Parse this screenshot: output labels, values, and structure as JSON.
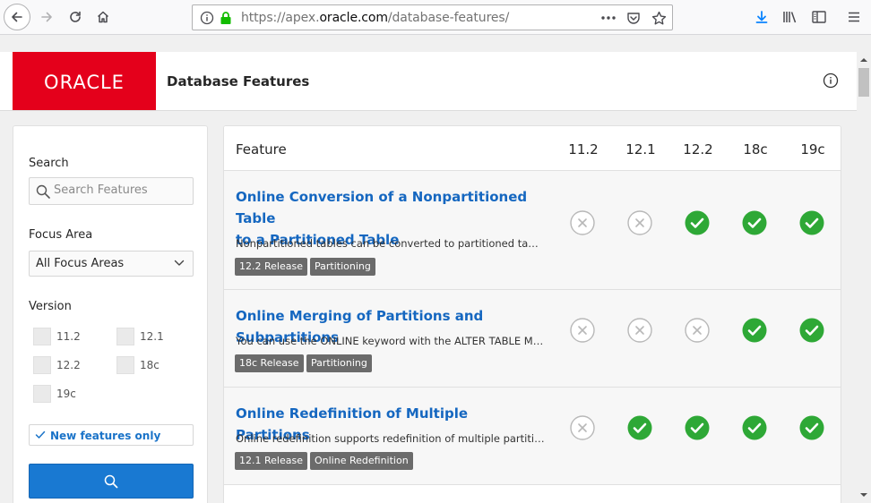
{
  "browser": {
    "url_prefix": "https://apex.",
    "url_host": "oracle.com",
    "url_path": "/database-features/"
  },
  "header": {
    "logo_text": "ORACLE",
    "title": "Database Features"
  },
  "sidebar": {
    "search_label": "Search",
    "search_placeholder": "Search Features",
    "focus_label": "Focus Area",
    "focus_value": "All Focus Areas",
    "version_label": "Version",
    "versions": [
      "11.2",
      "12.1",
      "12.2",
      "18c",
      "19c"
    ],
    "new_features_label": "New features only"
  },
  "table": {
    "feature_header": "Feature",
    "version_headers": [
      "11.2",
      "12.1",
      "12.2",
      "18c",
      "19c"
    ],
    "rows": [
      {
        "title_line1": "Online Conversion of a Nonpartitioned Table",
        "title_line2": "to a Partitioned Table",
        "description": "Nonpartitioned tables can be converted to partitioned tables o...",
        "tags": [
          "12.2 Release",
          "Partitioning"
        ],
        "support": [
          false,
          false,
          true,
          true,
          true
        ]
      },
      {
        "title_line1": "Online Merging of Partitions and Subpartitions",
        "title_line2": "",
        "description": "You can use the ONLINE keyword with the ALTER TABLE MERG...",
        "tags": [
          "18c Release",
          "Partitioning"
        ],
        "support": [
          false,
          false,
          false,
          true,
          true
        ]
      },
      {
        "title_line1": "Online Redefinition of Multiple Partitions",
        "title_line2": "",
        "description": "Online redefinition supports redefinition of multiple partitions i...",
        "tags": [
          "12.1 Release",
          "Online Redefinition"
        ],
        "support": [
          false,
          true,
          true,
          true,
          true
        ]
      }
    ]
  },
  "colors": {
    "oracle_red": "#e4001b",
    "link_blue": "#1567c0",
    "check_green": "#2ea836",
    "cross_gray": "#b8b8b8",
    "button_blue": "#1979d2"
  }
}
